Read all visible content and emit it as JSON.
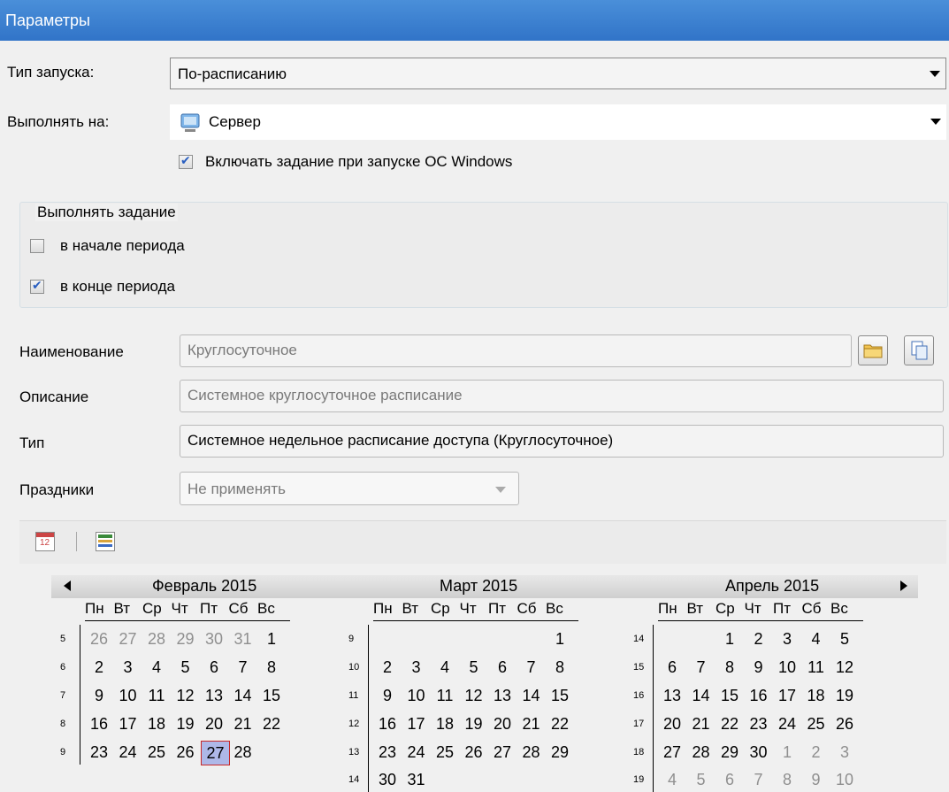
{
  "window": {
    "title": "Параметры"
  },
  "run_type": {
    "label": "Тип запуска:",
    "value": "По-расписанию"
  },
  "run_on": {
    "label": "Выполнять на:",
    "value": "Сервер"
  },
  "enable_on_startup": {
    "label": "Включать задание при запуске ОС Windows",
    "checked": true
  },
  "execute_group": {
    "title": "Выполнять задание",
    "start": {
      "label": "в начале периода",
      "checked": false
    },
    "end": {
      "label": "в конце периода",
      "checked": true
    }
  },
  "schedule": {
    "name_label": "Наименование",
    "name_value": "Круглосуточное",
    "desc_label": "Описание",
    "desc_value": "Системное круглосуточное расписание",
    "type_label": "Тип",
    "type_value": "Системное недельное расписание доступа (Круглосуточное)",
    "holidays_label": "Праздники",
    "holidays_value": "Не применять"
  },
  "toolbar": {
    "icons": [
      "calendar-icon",
      "schedule-grid-icon"
    ]
  },
  "calendar": {
    "weekdays": [
      "Пн",
      "Вт",
      "Ср",
      "Чт",
      "Пт",
      "Сб",
      "Вс"
    ],
    "selected": "27 Февраль 2015",
    "months": [
      {
        "title": "Февраль 2015",
        "weeks": [
          {
            "num": "5",
            "days": [
              [
                "26",
                1
              ],
              [
                "27",
                1
              ],
              [
                "28",
                1
              ],
              [
                "29",
                1
              ],
              [
                "30",
                1
              ],
              [
                "31",
                1
              ],
              [
                "1",
                0
              ]
            ]
          },
          {
            "num": "6",
            "days": [
              [
                "2",
                0
              ],
              [
                "3",
                0
              ],
              [
                "4",
                0
              ],
              [
                "5",
                0
              ],
              [
                "6",
                0
              ],
              [
                "7",
                0
              ],
              [
                "8",
                0
              ]
            ]
          },
          {
            "num": "7",
            "days": [
              [
                "9",
                0
              ],
              [
                "10",
                0
              ],
              [
                "11",
                0
              ],
              [
                "12",
                0
              ],
              [
                "13",
                0
              ],
              [
                "14",
                0
              ],
              [
                "15",
                0
              ]
            ]
          },
          {
            "num": "8",
            "days": [
              [
                "16",
                0
              ],
              [
                "17",
                0
              ],
              [
                "18",
                0
              ],
              [
                "19",
                0
              ],
              [
                "20",
                0
              ],
              [
                "21",
                0
              ],
              [
                "22",
                0
              ]
            ]
          },
          {
            "num": "9",
            "days": [
              [
                "23",
                0
              ],
              [
                "24",
                0
              ],
              [
                "25",
                0
              ],
              [
                "26",
                0
              ],
              [
                "27",
                2
              ],
              [
                "28",
                0
              ],
              [
                "",
                0
              ]
            ]
          }
        ]
      },
      {
        "title": "Март 2015",
        "weeks": [
          {
            "num": "9",
            "days": [
              [
                "",
                0
              ],
              [
                "",
                0
              ],
              [
                "",
                0
              ],
              [
                "",
                0
              ],
              [
                "",
                0
              ],
              [
                "",
                0
              ],
              [
                "1",
                0
              ]
            ]
          },
          {
            "num": "10",
            "days": [
              [
                "2",
                0
              ],
              [
                "3",
                0
              ],
              [
                "4",
                0
              ],
              [
                "5",
                0
              ],
              [
                "6",
                0
              ],
              [
                "7",
                0
              ],
              [
                "8",
                0
              ]
            ]
          },
          {
            "num": "11",
            "days": [
              [
                "9",
                0
              ],
              [
                "10",
                0
              ],
              [
                "11",
                0
              ],
              [
                "12",
                0
              ],
              [
                "13",
                0
              ],
              [
                "14",
                0
              ],
              [
                "15",
                0
              ]
            ]
          },
          {
            "num": "12",
            "days": [
              [
                "16",
                0
              ],
              [
                "17",
                0
              ],
              [
                "18",
                0
              ],
              [
                "19",
                0
              ],
              [
                "20",
                0
              ],
              [
                "21",
                0
              ],
              [
                "22",
                0
              ]
            ]
          },
          {
            "num": "13",
            "days": [
              [
                "23",
                0
              ],
              [
                "24",
                0
              ],
              [
                "25",
                0
              ],
              [
                "26",
                0
              ],
              [
                "27",
                0
              ],
              [
                "28",
                0
              ],
              [
                "29",
                0
              ]
            ]
          },
          {
            "num": "14",
            "days": [
              [
                "30",
                0
              ],
              [
                "31",
                0
              ],
              [
                "",
                0
              ],
              [
                "",
                0
              ],
              [
                "",
                0
              ],
              [
                "",
                0
              ],
              [
                "",
                0
              ]
            ]
          }
        ]
      },
      {
        "title": "Апрель 2015",
        "weeks": [
          {
            "num": "14",
            "days": [
              [
                "",
                0
              ],
              [
                "",
                0
              ],
              [
                "1",
                0
              ],
              [
                "2",
                0
              ],
              [
                "3",
                0
              ],
              [
                "4",
                0
              ],
              [
                "5",
                0
              ]
            ]
          },
          {
            "num": "15",
            "days": [
              [
                "6",
                0
              ],
              [
                "7",
                0
              ],
              [
                "8",
                0
              ],
              [
                "9",
                0
              ],
              [
                "10",
                0
              ],
              [
                "11",
                0
              ],
              [
                "12",
                0
              ]
            ]
          },
          {
            "num": "16",
            "days": [
              [
                "13",
                0
              ],
              [
                "14",
                0
              ],
              [
                "15",
                0
              ],
              [
                "16",
                0
              ],
              [
                "17",
                0
              ],
              [
                "18",
                0
              ],
              [
                "19",
                0
              ]
            ]
          },
          {
            "num": "17",
            "days": [
              [
                "20",
                0
              ],
              [
                "21",
                0
              ],
              [
                "22",
                0
              ],
              [
                "23",
                0
              ],
              [
                "24",
                0
              ],
              [
                "25",
                0
              ],
              [
                "26",
                0
              ]
            ]
          },
          {
            "num": "18",
            "days": [
              [
                "27",
                0
              ],
              [
                "28",
                0
              ],
              [
                "29",
                0
              ],
              [
                "30",
                0
              ],
              [
                "1",
                1
              ],
              [
                "2",
                1
              ],
              [
                "3",
                1
              ]
            ]
          },
          {
            "num": "19",
            "days": [
              [
                "4",
                1
              ],
              [
                "5",
                1
              ],
              [
                "6",
                1
              ],
              [
                "7",
                1
              ],
              [
                "8",
                1
              ],
              [
                "9",
                1
              ],
              [
                "10",
                1
              ]
            ]
          }
        ]
      }
    ]
  }
}
